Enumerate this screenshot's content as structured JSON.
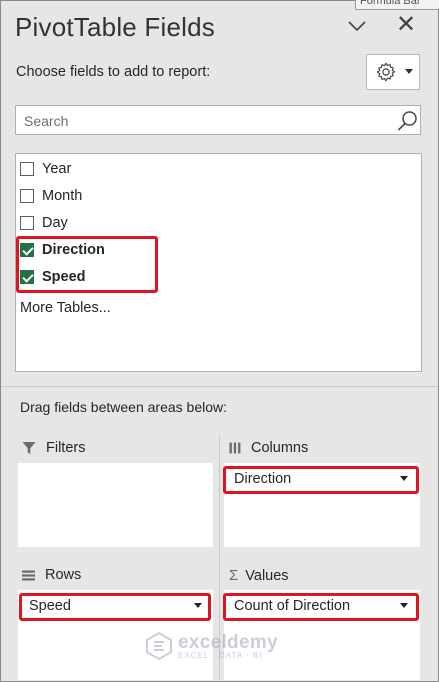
{
  "header": {
    "title": "PivotTable Fields",
    "tooltip_fragment": "Formula Bar",
    "close_glyph": "✕"
  },
  "choose_label": "Choose fields to add to report:",
  "search": {
    "placeholder": "Search"
  },
  "fields": [
    {
      "name": "Year",
      "checked": false
    },
    {
      "name": "Month",
      "checked": false
    },
    {
      "name": "Day",
      "checked": false
    },
    {
      "name": "Direction",
      "checked": true
    },
    {
      "name": "Speed",
      "checked": true
    }
  ],
  "more_tables": "More Tables...",
  "drag_label": "Drag fields between areas below:",
  "areas": {
    "filters": {
      "label": "Filters"
    },
    "columns": {
      "label": "Columns",
      "item": "Direction"
    },
    "rows": {
      "label": "Rows",
      "item": "Speed"
    },
    "values": {
      "label": "Values",
      "item": "Count of Direction"
    }
  },
  "watermark": {
    "name": "exceldemy",
    "tagline": "EXCEL · DATA · BI"
  },
  "colors": {
    "highlight": "#e0141e",
    "checkbox_checked": "#217346",
    "pane_bg": "#e6e6e6"
  }
}
